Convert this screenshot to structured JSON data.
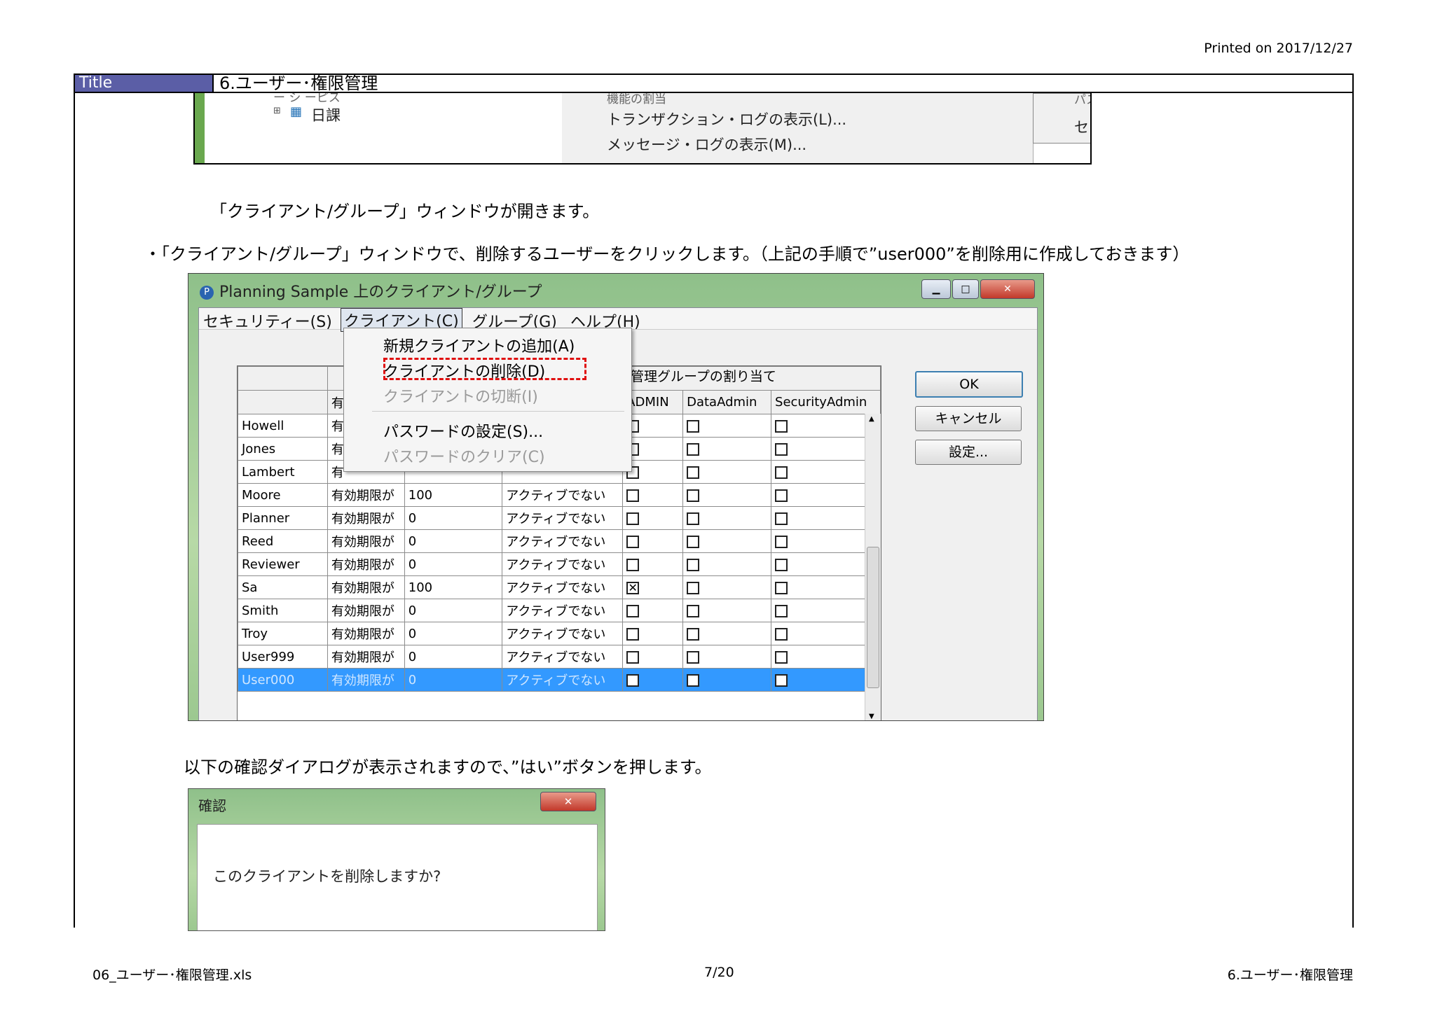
{
  "header": {
    "printed": "Printed on 2017/12/27",
    "title_label": "Title",
    "title_value": "6.ユーザー･権限管理"
  },
  "top_screenshot": {
    "cut_left": "ー シ ーピス",
    "tree_item": "日課",
    "cut_menu_top": "機能の割当",
    "menu_items": [
      "トランザクション・ログの表示(L)...",
      "メッセージ・ログの表示(M)..."
    ],
    "cut_menu2_top": "パスワードの変更(P)...",
    "menu2_items": [
      "セキュリティーの更新(S)"
    ]
  },
  "paragraphs": {
    "p1": "「クライアント/グループ」ウィンドウが開きます。",
    "p2": "・「クライアント/グループ」ウィンドウで、削除するユーザーをクリックします。（上記の手順で”user000”を削除用に作成しておきます）",
    "p3": "以下の確認ダイアログが表示されますので、”はい”ボタンを押します。"
  },
  "main_window": {
    "title": "Planning Sample 上のクライアント/グループ",
    "menubar": [
      "セキュリティー(S)",
      "クライアント(C)",
      "グループ(G)",
      "ヘルプ(H)"
    ],
    "dropdown": {
      "items": [
        "新規クライアントの追加(A)",
        "クライアントの削除(D)",
        "クライアントの切断(I)",
        "パスワードの設定(S)...",
        "パスワードのクリア(C)"
      ]
    },
    "group_header": "管理グループの割り当て",
    "columns": [
      "ADMIN",
      "DataAdmin",
      "SecurityAdmin"
    ],
    "header_partial": "有",
    "rows": [
      {
        "name": "Howell",
        "status": "有",
        "num": "",
        "active": "",
        "admin": false
      },
      {
        "name": "Jones",
        "status": "有",
        "num": "",
        "active": "",
        "admin": false
      },
      {
        "name": "Lambert",
        "status": "有",
        "num": "",
        "active": "",
        "admin": false
      },
      {
        "name": "Moore",
        "status": "有効期限が",
        "num": "100",
        "active": "アクティブでない",
        "admin": false
      },
      {
        "name": "Planner",
        "status": "有効期限が",
        "num": "0",
        "active": "アクティブでない",
        "admin": false
      },
      {
        "name": "Reed",
        "status": "有効期限が",
        "num": "0",
        "active": "アクティブでない",
        "admin": false
      },
      {
        "name": "Reviewer",
        "status": "有効期限が",
        "num": "0",
        "active": "アクティブでない",
        "admin": false
      },
      {
        "name": "Sa",
        "status": "有効期限が",
        "num": "100",
        "active": "アクティブでない",
        "admin": true
      },
      {
        "name": "Smith",
        "status": "有効期限が",
        "num": "0",
        "active": "アクティブでない",
        "admin": false
      },
      {
        "name": "Troy",
        "status": "有効期限が",
        "num": "0",
        "active": "アクティブでない",
        "admin": false
      },
      {
        "name": "User999",
        "status": "有効期限が",
        "num": "0",
        "active": "アクティブでない",
        "admin": false
      },
      {
        "name": "User000",
        "status": "有効期限が",
        "num": "0",
        "active": "アクティブでない",
        "admin": false,
        "selected": true
      }
    ],
    "buttons": [
      "OK",
      "キャンセル",
      "設定..."
    ]
  },
  "confirm_dialog": {
    "title": "確認",
    "message": "このクライアントを削除しますか?"
  },
  "footer": {
    "file": "06_ユーザー･権限管理.xls",
    "page": "7/20",
    "sheet": "6.ユーザー･権限管理"
  }
}
